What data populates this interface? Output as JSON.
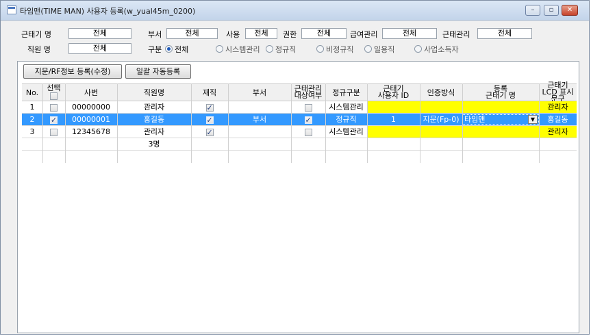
{
  "window": {
    "title": "타임맨(TIME MAN) 사용자 등록(w_yual45m_0200)"
  },
  "filters": {
    "terminal_name": {
      "label": "근태기 명",
      "value": "전체"
    },
    "department": {
      "label": "부서",
      "value": "전체"
    },
    "use": {
      "label": "사용",
      "value": "전체"
    },
    "permission": {
      "label": "권한",
      "value": "전체"
    },
    "payroll": {
      "label": "급여관리",
      "value": "전체"
    },
    "attendance": {
      "label": "근태관리",
      "value": "전체"
    },
    "employee_name": {
      "label": "직원 명",
      "value": "전체"
    },
    "category": {
      "label": "구분",
      "options": [
        "전체",
        "시스템관리",
        "정규직",
        "비정규직",
        "일용직",
        "사업소득자"
      ],
      "selected": "전체"
    }
  },
  "toolbar": {
    "register_fingerprint_label": "지문/RF정보 등록(수정)",
    "bulk_register_label": "일괄 자동등록"
  },
  "table": {
    "headers": {
      "no": "No.",
      "select": "선택",
      "emp_no": "사번",
      "name": "직원명",
      "active": "재직",
      "dept": "부서",
      "att_managed_1": "근태관리",
      "att_managed_2": "대상여부",
      "regular_type": "정규구분",
      "terminal_user_1": "근태기",
      "terminal_user_2": "사용자 ID",
      "auth_method": "인증방식",
      "reg_terminal_1": "등록",
      "reg_terminal_2": "근태기 명",
      "lcd_1": "근태기",
      "lcd_2": "LCD 표시문구"
    },
    "rows": [
      {
        "no": "1",
        "selected": false,
        "emp_no": "00000000",
        "name": "관리자",
        "active": true,
        "dept": "",
        "att_managed": false,
        "regular_type": "시스템관리",
        "terminal_user_id": "",
        "auth_method": "",
        "reg_terminal": "",
        "lcd_text": "관리자"
      },
      {
        "no": "2",
        "selected": true,
        "emp_no": "00000001",
        "name": "홍길동",
        "active": true,
        "dept": "부서",
        "att_managed": true,
        "regular_type": "정규직",
        "terminal_user_id": "1",
        "auth_method": "지문(Fp-0)",
        "reg_terminal": "타임맨",
        "lcd_text": "홍길동"
      },
      {
        "no": "3",
        "selected": false,
        "emp_no": "12345678",
        "name": "관리자",
        "active": true,
        "dept": "",
        "att_managed": false,
        "regular_type": "시스템관리",
        "terminal_user_id": "",
        "auth_method": "",
        "reg_terminal": "",
        "lcd_text": "관리자"
      }
    ],
    "summary_count": "3명"
  },
  "colors": {
    "selection": "#3399ff",
    "highlight": "#ffff00"
  }
}
